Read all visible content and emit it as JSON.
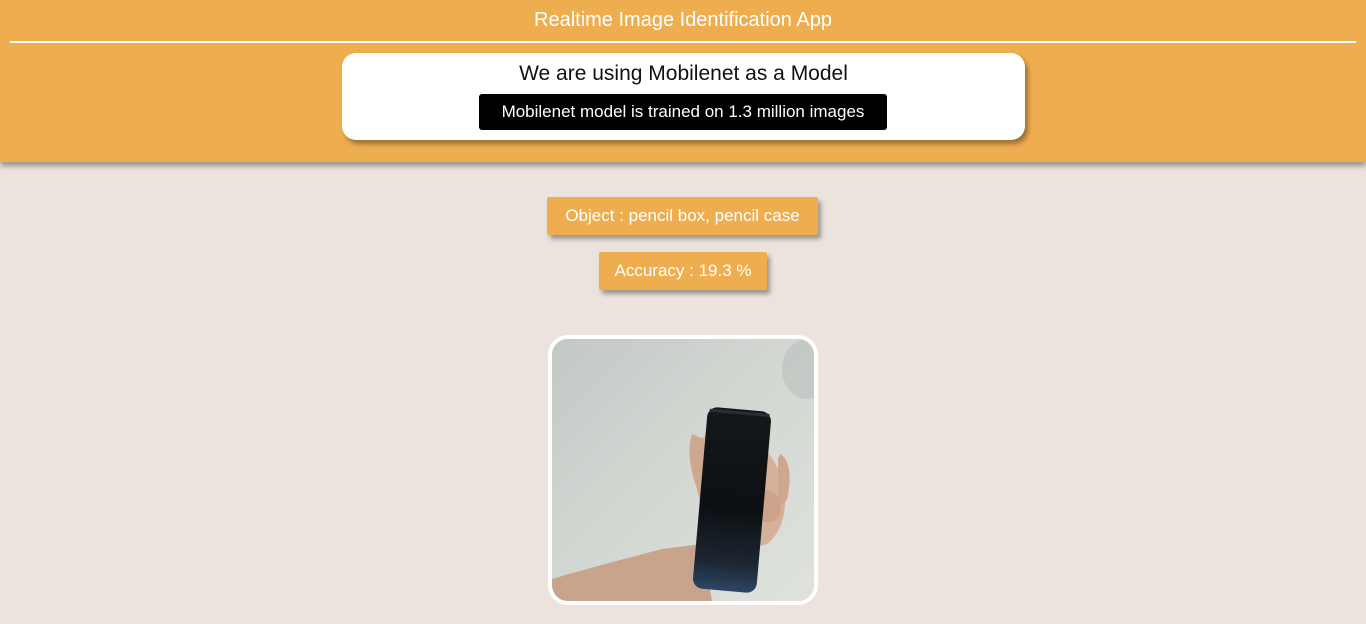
{
  "header": {
    "title": "Realtime Image Identification App",
    "background_color": "#eead4f"
  },
  "info_card": {
    "heading": "We are using Mobilenet as a Model",
    "badge": "Mobilenet model is trained on 1.3 million images"
  },
  "results": {
    "object_text": "Object : pencil box, pencil case",
    "accuracy_text": "Accuracy : 19.3 %"
  },
  "camera": {
    "icon": "webcam-feed"
  }
}
